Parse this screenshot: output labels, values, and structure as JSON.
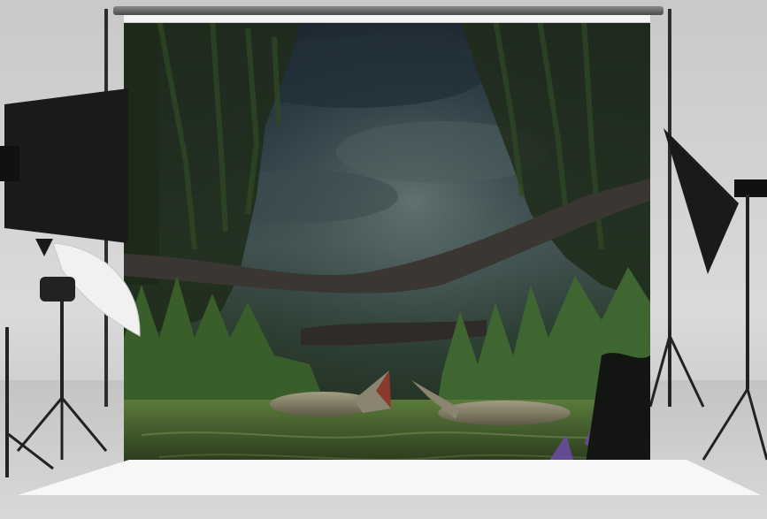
{
  "scene": {
    "icons": {
      "softbox_left": "softbox-icon",
      "softbox_right": "softbox-icon",
      "umbrella_light": "umbrella-light-icon",
      "tripod": "tripod-icon"
    },
    "colors": {
      "sky_dark": "#1b2630",
      "sky_mid": "#41524f",
      "foliage": "#2f4a25",
      "grass": "#4f7a3a",
      "water": "#3e5a2e",
      "branch": "#3a3632",
      "crocodile": "#8a8470",
      "studio_wall": "#cfcfcf",
      "paper": "#f5f5f5"
    }
  }
}
